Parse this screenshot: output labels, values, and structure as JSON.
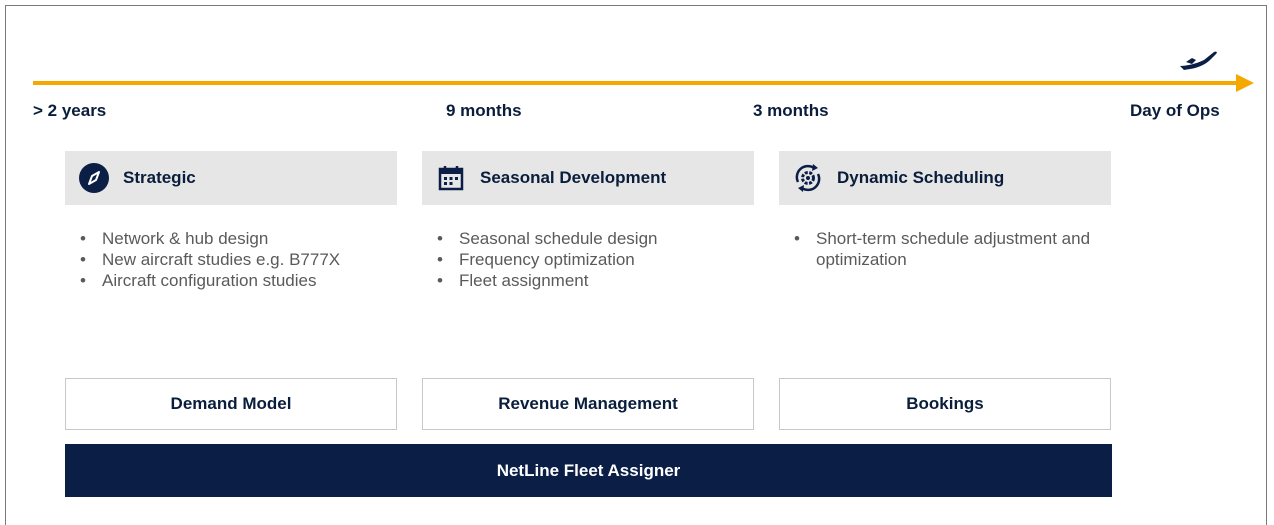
{
  "timeline": {
    "labels": [
      "> 2 years",
      "9 months",
      "3 months",
      "Day of Ops"
    ],
    "arrow_color": "#f5a800",
    "end_icon": "airplane-icon"
  },
  "phases": [
    {
      "title": "Strategic",
      "icon": "compass-icon",
      "bullets": [
        "Network & hub design",
        "New aircraft studies e.g. B777X",
        "Aircraft configuration studies"
      ]
    },
    {
      "title": "Seasonal Development",
      "icon": "calendar-icon",
      "bullets": [
        "Seasonal schedule design",
        "Frequency optimization",
        "Fleet assignment"
      ]
    },
    {
      "title": "Dynamic Scheduling",
      "icon": "gear-cycle-icon",
      "bullets": [
        "Short-term schedule adjustment and optimization"
      ]
    }
  ],
  "inputs": [
    "Demand Model",
    "Revenue Management",
    "Bookings"
  ],
  "bar_label": "NetLine Fleet Assigner",
  "colors": {
    "navy": "#0a1e46",
    "accent": "#f5a800",
    "panel": "#e6e6e6"
  }
}
